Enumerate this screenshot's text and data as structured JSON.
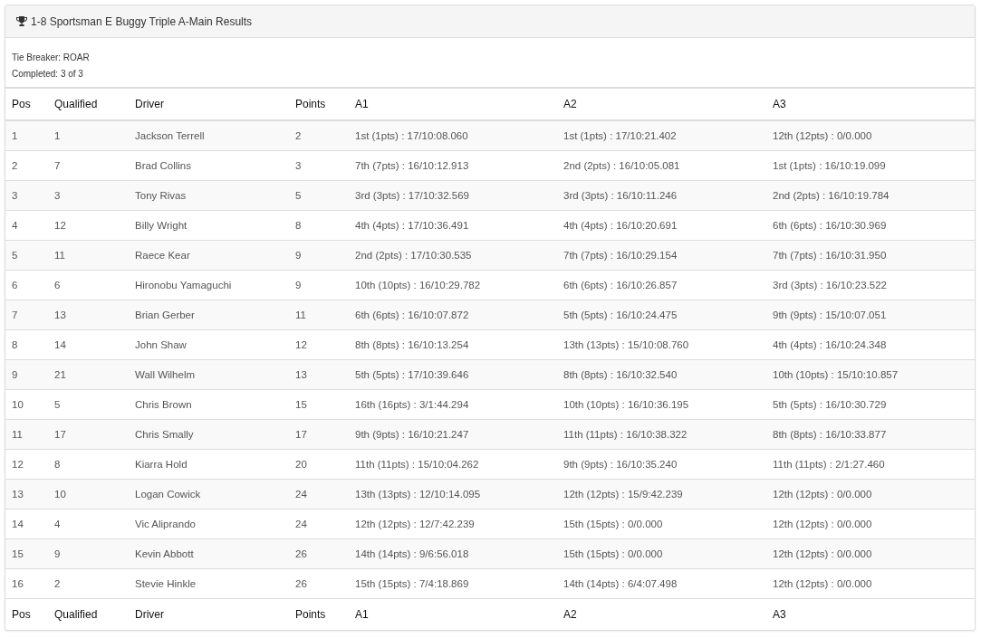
{
  "panel": {
    "title": "1-8 Sportsman E Buggy Triple A-Main Results"
  },
  "info": [
    "Tie Breaker: ROAR",
    "Completed: 3 of 3"
  ],
  "table": {
    "columns": [
      "Pos",
      "Qualified",
      "Driver",
      "Points",
      "A1",
      "A2",
      "A3"
    ],
    "rows": [
      [
        "1",
        "1",
        "Jackson Terrell",
        "2",
        "1st (1pts) : 17/10:08.060",
        "1st (1pts) : 17/10:21.402",
        "12th (12pts) : 0/0.000"
      ],
      [
        "2",
        "7",
        "Brad Collins",
        "3",
        "7th (7pts) : 16/10:12.913",
        "2nd (2pts) : 16/10:05.081",
        "1st (1pts) : 16/10:19.099"
      ],
      [
        "3",
        "3",
        "Tony Rivas",
        "5",
        "3rd (3pts) : 17/10:32.569",
        "3rd (3pts) : 16/10:11.246",
        "2nd (2pts) : 16/10:19.784"
      ],
      [
        "4",
        "12",
        "Billy Wright",
        "8",
        "4th (4pts) : 17/10:36.491",
        "4th (4pts) : 16/10:20.691",
        "6th (6pts) : 16/10:30.969"
      ],
      [
        "5",
        "11",
        "Raece Kear",
        "9",
        "2nd (2pts) : 17/10:30.535",
        "7th (7pts) : 16/10:29.154",
        "7th (7pts) : 16/10:31.950"
      ],
      [
        "6",
        "6",
        "Hironobu Yamaguchi",
        "9",
        "10th (10pts) : 16/10:29.782",
        "6th (6pts) : 16/10:26.857",
        "3rd (3pts) : 16/10:23.522"
      ],
      [
        "7",
        "13",
        "Brian Gerber",
        "11",
        "6th (6pts) : 16/10:07.872",
        "5th (5pts) : 16/10:24.475",
        "9th (9pts) : 15/10:07.051"
      ],
      [
        "8",
        "14",
        "John Shaw",
        "12",
        "8th (8pts) : 16/10:13.254",
        "13th (13pts) : 15/10:08.760",
        "4th (4pts) : 16/10:24.348"
      ],
      [
        "9",
        "21",
        "Wall Wilhelm",
        "13",
        "5th (5pts) : 17/10:39.646",
        "8th (8pts) : 16/10:32.540",
        "10th (10pts) : 15/10:10.857"
      ],
      [
        "10",
        "5",
        "Chris Brown",
        "15",
        "16th (16pts) : 3/1:44.294",
        "10th (10pts) : 16/10:36.195",
        "5th (5pts) : 16/10:30.729"
      ],
      [
        "11",
        "17",
        "Chris Smally",
        "17",
        "9th (9pts) : 16/10:21.247",
        "11th (11pts) : 16/10:38.322",
        "8th (8pts) : 16/10:33.877"
      ],
      [
        "12",
        "8",
        "Kiarra Hold",
        "20",
        "11th (11pts) : 15/10:04.262",
        "9th (9pts) : 16/10:35.240",
        "11th (11pts) : 2/1:27.460"
      ],
      [
        "13",
        "10",
        "Logan Cowick",
        "24",
        "13th (13pts) : 12/10:14.095",
        "12th (12pts) : 15/9:42.239",
        "12th (12pts) : 0/0.000"
      ],
      [
        "14",
        "4",
        "Vic Aliprando",
        "24",
        "12th (12pts) : 12/7:42.239",
        "15th (15pts) : 0/0.000",
        "12th (12pts) : 0/0.000"
      ],
      [
        "15",
        "9",
        "Kevin Abbott",
        "26",
        "14th (14pts) : 9/6:56.018",
        "15th (15pts) : 0/0.000",
        "12th (12pts) : 0/0.000"
      ],
      [
        "16",
        "2",
        "Stevie Hinkle",
        "26",
        "15th (15pts) : 7/4:18.869",
        "14th (14pts) : 6/4:07.498",
        "12th (12pts) : 0/0.000"
      ]
    ],
    "footer": [
      "Pos",
      "Qualified",
      "Driver",
      "Points",
      "A1",
      "A2",
      "A3"
    ]
  }
}
